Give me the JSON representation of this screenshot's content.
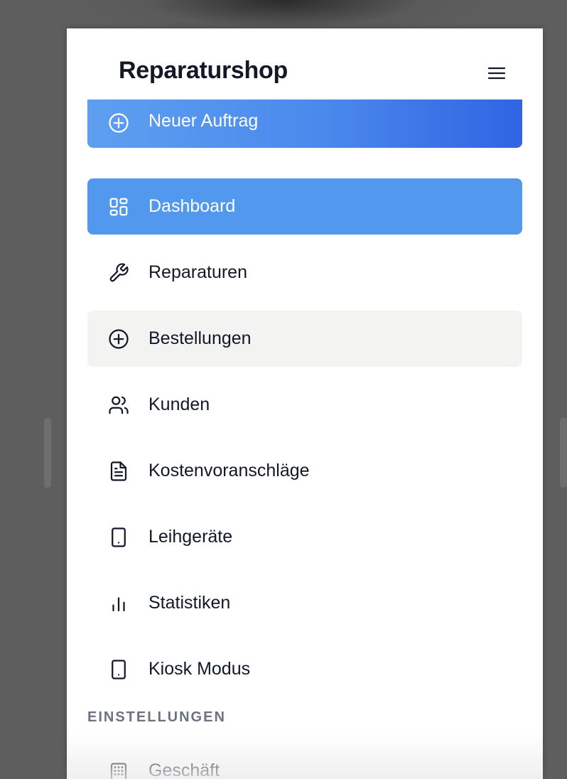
{
  "app": {
    "title": "Reparaturshop"
  },
  "new_order": {
    "label": "Neuer Auftrag",
    "icon": "plus-circle-icon"
  },
  "nav": {
    "items": [
      {
        "label": "Dashboard",
        "icon": "dashboard-grid-icon",
        "state": "active"
      },
      {
        "label": "Reparaturen",
        "icon": "wrench-icon"
      },
      {
        "label": "Bestellungen",
        "icon": "plus-circle-icon",
        "state": "hover"
      },
      {
        "label": "Kunden",
        "icon": "users-icon"
      },
      {
        "label": "Kostenvoranschläge",
        "icon": "document-icon"
      },
      {
        "label": "Leihgeräte",
        "icon": "tablet-icon"
      },
      {
        "label": "Statistiken",
        "icon": "bar-chart-icon"
      },
      {
        "label": "Kiosk Modus",
        "icon": "tablet-icon"
      }
    ]
  },
  "settings": {
    "heading": "EINSTELLUNGEN",
    "items": [
      {
        "label": "Geschäft",
        "icon": "building-icon"
      }
    ]
  },
  "colors": {
    "accent": "#5398ef",
    "gradient_start": "#5e9ff0",
    "gradient_end": "#3064e3",
    "text": "#111827",
    "muted": "#6b7280",
    "hover_bg": "#f3f3f2"
  }
}
